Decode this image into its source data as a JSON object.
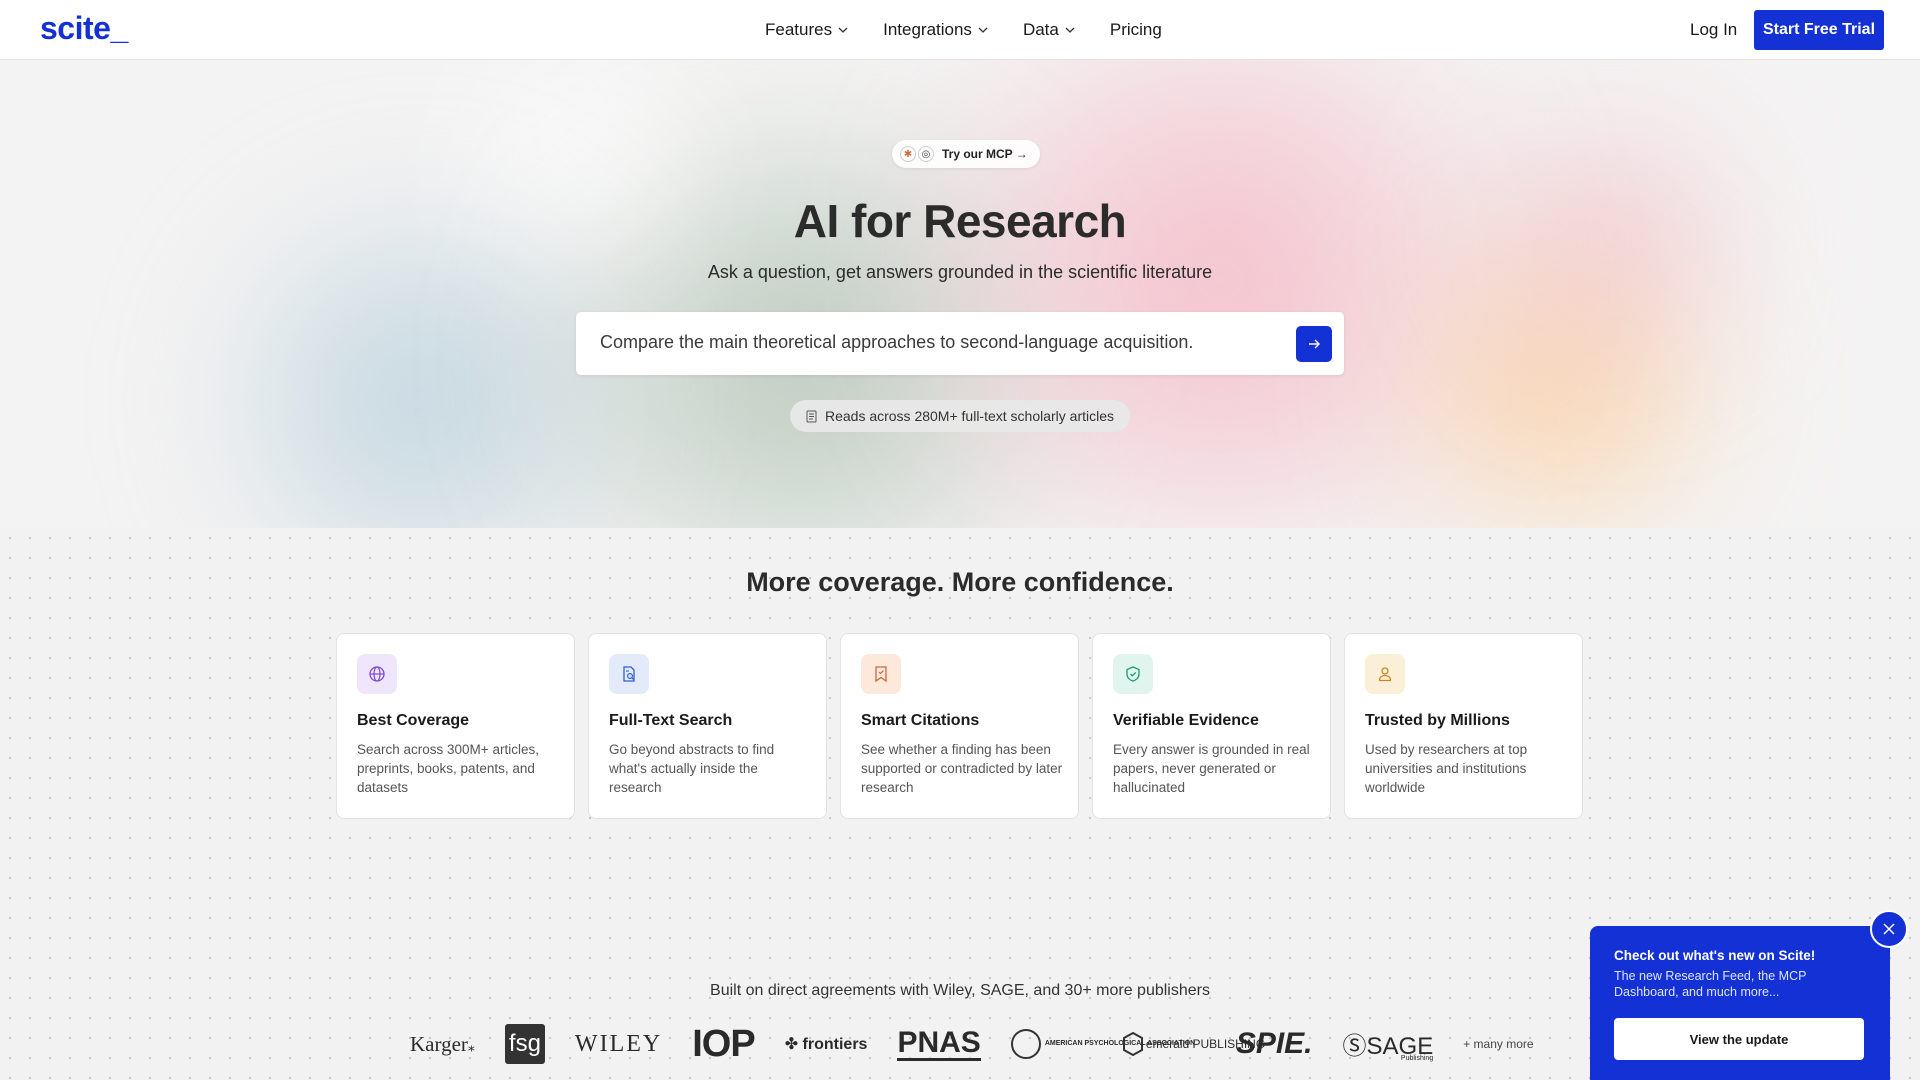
{
  "header": {
    "logo": "scite_",
    "nav": [
      {
        "label": "Features",
        "has_dropdown": true
      },
      {
        "label": "Integrations",
        "has_dropdown": true
      },
      {
        "label": "Data",
        "has_dropdown": true
      },
      {
        "label": "Pricing",
        "has_dropdown": false
      }
    ],
    "login_label": "Log In",
    "cta_label": "Start Free Trial"
  },
  "hero": {
    "mcp_pill": "Try our MCP →",
    "title": "AI for Research",
    "subtitle": "Ask a question, get answers grounded in the scientific literature",
    "search_value": "Compare the main theoretical approaches to second-language acquisition.",
    "reads_label": "Reads across 280M+ full-text scholarly articles"
  },
  "coverage": {
    "title": "More coverage. More confidence.",
    "cards": [
      {
        "icon": "globe-icon",
        "title": "Best Coverage",
        "desc": "Search across 300M+ articles, preprints, books, patents, and datasets",
        "color": "#efe6fb"
      },
      {
        "icon": "document-search-icon",
        "title": "Full-Text Search",
        "desc": "Go beyond abstracts to find what's actually inside the research",
        "color": "#e3ebfb"
      },
      {
        "icon": "bookmark-icon",
        "title": "Smart Citations",
        "desc": "See whether a finding has been supported or contradicted by later research",
        "color": "#fde9dc"
      },
      {
        "icon": "shield-check-icon",
        "title": "Verifiable Evidence",
        "desc": "Every answer is grounded in real papers, never generated or hallucinated",
        "color": "#dff5ee"
      },
      {
        "icon": "user-icon",
        "title": "Trusted by Millions",
        "desc": "Used by researchers at top universities and institutions worldwide",
        "color": "#fcefd8"
      }
    ]
  },
  "publishers": {
    "line": "Built on direct agreements with Wiley, SAGE, and 30+ more publishers",
    "logos": {
      "karger": "Karger",
      "fsg": "fsg",
      "wiley": "WILEY",
      "iop": "IOP",
      "frontiers": "frontiers",
      "pnas": "PNAS",
      "apa": "AMERICAN PSYCHOLOGICAL ASSOCIATION",
      "emerald": "emerald PUBLISHING",
      "spie": "SPIE.",
      "sage": "SAGE",
      "sage_sub": "Publishing"
    },
    "more": "+ many more"
  },
  "popup": {
    "title": "Check out what's new on Scite!",
    "body": "The new Research Feed, the MCP Dashboard, and much more...",
    "button": "View the update"
  },
  "colors": {
    "brand": "#1431d6"
  }
}
